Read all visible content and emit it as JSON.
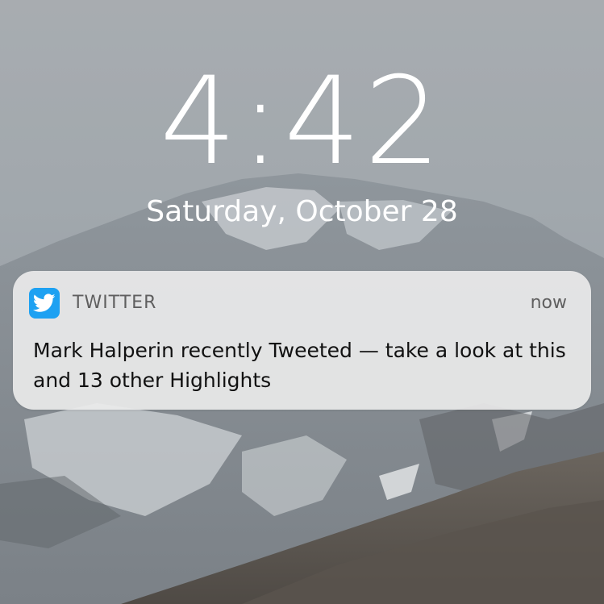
{
  "lockscreen": {
    "time": "4:42",
    "date": "Saturday, October 28"
  },
  "notification": {
    "app_name": "TWITTER",
    "app_icon": "twitter-bird-icon",
    "time": "now",
    "message": "Mark Halperin recently Tweeted — take a look at this and 13 other Highlights"
  },
  "colors": {
    "twitter_blue": "#1da1f2",
    "text_white": "#ffffff",
    "notification_bg": "#ececec"
  }
}
